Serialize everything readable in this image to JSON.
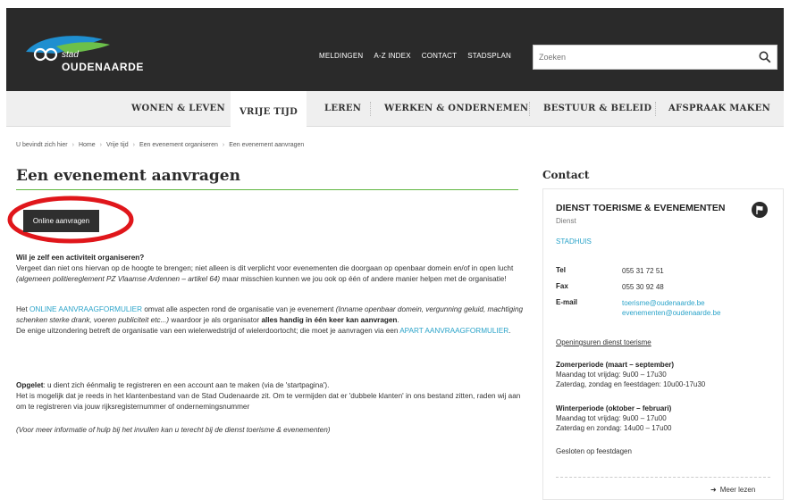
{
  "header": {
    "logo_small": "stad",
    "logo_big": "OUDENAARDE",
    "top_nav": [
      "MELDINGEN",
      "A-Z INDEX",
      "CONTACT",
      "STADSPLAN"
    ],
    "search_placeholder": "Zoeken"
  },
  "main_nav": {
    "items": [
      "WONEN & LEVEN",
      "VRIJE TIJD",
      "LEREN",
      "WERKEN & ONDERNEMEN",
      "BESTUUR & BELEID",
      "AFSPRAAK MAKEN"
    ],
    "active": "VRIJE TIJD"
  },
  "breadcrumb": [
    "U bevindt zich hier",
    "Home",
    "Vrije tijd",
    "Een evenement organiseren",
    "Een evenement aanvragen"
  ],
  "main": {
    "title": "Een evenement aanvragen",
    "cta_label": "Online aanvragen",
    "p1_heading": "Wil je zelf een activiteit organiseren?",
    "p1_text_a": "Vergeet dan niet ons hiervan op de hoogte te brengen; niet alleen is dit verplicht voor evenementen die doorgaan op openbaar domein en/of in open lucht ",
    "p1_italic": "(algemeen politiereglement PZ Vlaamse Ardennen – artikel 64)",
    "p1_text_b": " maar misschien kunnen we jou ook op één of andere manier helpen met de organisatie!",
    "p2_a": "Het ",
    "p2_link1": "ONLINE AANVRAAGFORMULIER",
    "p2_b": " omvat alle aspecten rond de organisatie van je evenement ",
    "p2_italic": "(Inname openbaar domein, vergunning geluid, machtiging schenken sterke drank, voeren publiciteit etc...)",
    "p2_c": " waardoor je als organisator ",
    "p2_bold": "alles handig in één keer kan aanvragen",
    "p2_d": ".",
    "p2_e": "De enige uitzondering betreft de organisatie van een wielerwedstrijd of wielerdoortocht; die moet je aanvragen via een ",
    "p2_link2": "APART AANVRAAGFORMULIER",
    "p2_f": ".",
    "p3_bold": "Opgelet",
    "p3_a": ": u dient zich éénmalig te registreren en een account aan te maken (via de 'startpagina').",
    "p3_b": "Het is mogelijk dat je reeds in het klantenbestand van de Stad Oudenaarde zit. Om te vermijden dat er 'dubbele klanten' in ons bestand zitten, raden wij aan om te registreren via jouw rijksregisternummer of ondernemingsnummer",
    "p4": "(Voor meer informatie of hulp bij het invullen kan u terecht bij de dienst toerisme & evenementen)"
  },
  "sidebar": {
    "title": "Contact",
    "name": "DIENST TOERISME & EVENEMENTEN",
    "role": "Dienst",
    "location": "STADHUIS",
    "tel_label": "Tel",
    "tel": "055 31 72 51",
    "fax_label": "Fax",
    "fax": "055 30 92 48",
    "email_label": "E-mail",
    "email1": "toerisme@oudenaarde.be",
    "email2": "evenementen@oudenaarde.be",
    "hours_link": "Openingsuren dienst toerisme",
    "summer_title": "Zomerperiode (maart – september)",
    "summer_l1": "Maandag tot vrijdag: 9u00 – 17u30",
    "summer_l2": "Zaterdag, zondag en feestdagen: 10u00-17u30",
    "winter_title": "Winterperiode (oktober – februari)",
    "winter_l1": "Maandag tot vrijdag: 9u00 – 17u00",
    "winter_l2": "Zaterdag en zondag: 14u00 – 17u00",
    "closed": "Gesloten op feestdagen",
    "more": "Meer lezen"
  },
  "colors": {
    "accent_green": "#5fb640",
    "link_blue": "#2aa3c9",
    "header_dark": "#2a2a2a",
    "highlight_red": "#e0161b"
  }
}
